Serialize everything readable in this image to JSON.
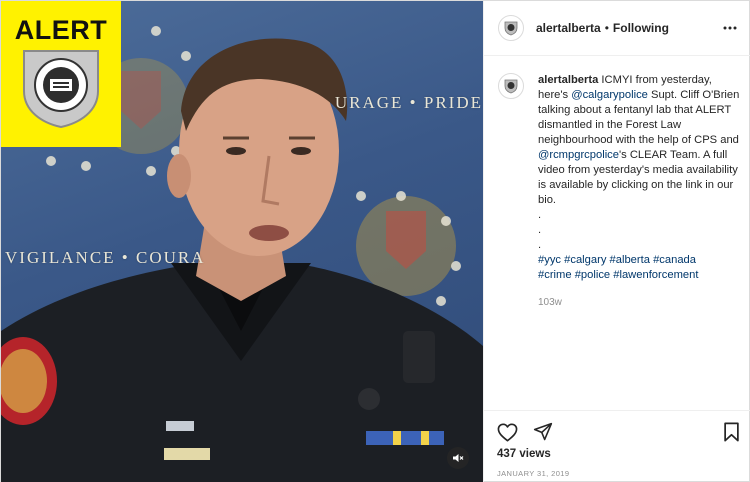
{
  "media": {
    "logo_word": "ALERT",
    "backdrop_text_top": "URAGE • PRIDE",
    "backdrop_text_left": "VIGILANCE • COURA",
    "mute_icon": "speaker-muted-icon"
  },
  "header": {
    "username": "alertalberta",
    "separator": "•",
    "follow_status": "Following",
    "more_icon": "ellipsis-icon"
  },
  "caption": {
    "username": "alertalberta",
    "text_1": " ICMYI from yesterday, here's ",
    "mention_1": "@calgarypolice",
    "text_2": " Supt. Cliff O'Brien talking about a fentanyl lab that ALERT dismantled in the Forest Law neighbourhood with the help of CPS and ",
    "mention_2": "@rcmpgrcpolice",
    "text_3": "'s CLEAR Team. A full video from yesterday's media availability is available by clicking on the link in our bio.",
    "dots": [
      ".",
      ".",
      "."
    ],
    "hashtags_line_1": [
      "#yyc",
      "#calgary",
      "#alberta",
      "#canada"
    ],
    "hashtags_line_2": [
      "#crime",
      "#police",
      "#lawenforcement"
    ],
    "time_ago": "103w"
  },
  "actions": {
    "like_icon": "heart-outline-icon",
    "share_icon": "paper-plane-icon",
    "save_icon": "bookmark-icon",
    "views": "437 views",
    "date": "JANUARY 31, 2019"
  }
}
